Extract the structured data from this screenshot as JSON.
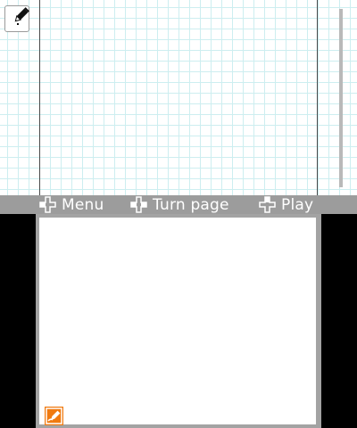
{
  "top_screen": {
    "pen_tool_icon": "pencil-icon",
    "grid_color": "#cdeef0"
  },
  "menu_bar": {
    "items": [
      {
        "label": "Menu",
        "icon": "dpad-left-icon"
      },
      {
        "label": "Turn page",
        "icon": "dpad-left-right-icon"
      },
      {
        "label": "Play",
        "icon": "dpad-up-icon"
      }
    ],
    "background_color": "#9c9c9c"
  },
  "bottom_screen": {
    "edit_button_icon": "pencil-edit-icon",
    "accent_color": "#f07a10"
  }
}
